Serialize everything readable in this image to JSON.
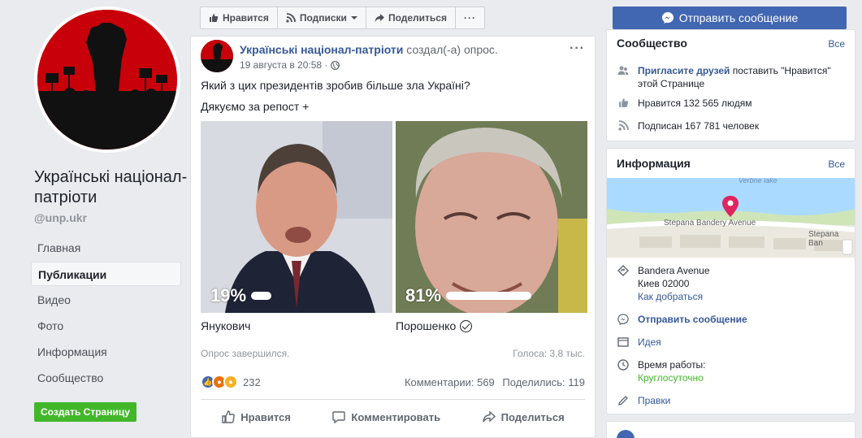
{
  "left": {
    "page_name": "Українські націонал-патріоти",
    "handle": "@unp.ukr",
    "nav": [
      "Главная",
      "Публикации",
      "Видео",
      "Фото",
      "Информация",
      "Сообщество"
    ],
    "create_page": "Создать Страницу"
  },
  "actionbar": {
    "like": "Нравится",
    "follow": "Подписки",
    "share": "Поделиться",
    "send_message": "Отправить сообщение"
  },
  "post": {
    "author": "Українські націонал-патріоти",
    "action": "создал(-а) опрос.",
    "date": "19 августа в 20:58 ·",
    "question": "Який з цих президентів зробив більше зла Україні?",
    "subtext": "Дякуємо за репост +",
    "options": [
      {
        "name": "Янукович",
        "percent_label": "19%",
        "percent": 19,
        "winner": false
      },
      {
        "name": "Порошенко",
        "percent_label": "81%",
        "percent": 81,
        "winner": true
      }
    ],
    "poll_status": "Опрос завершился.",
    "votes": "Голоса: 3,8 тыс.",
    "reaction_count": "232",
    "comments": "Комментарии: 569",
    "shares": "Поделились: 119",
    "btn_like": "Нравится",
    "btn_comment": "Комментировать",
    "btn_share": "Поделиться"
  },
  "community": {
    "title": "Сообщество",
    "see_all": "Все",
    "invite_link": "Пригласите друзей",
    "invite_rest": "поставить \"Нравится\" этой Странице",
    "likes": "Нравится 132 565 людям",
    "followers": "Подписан 167 781 человек"
  },
  "info": {
    "title": "Информация",
    "see_all": "Все",
    "map_label_1": "Stepana Bandery Avenue",
    "map_label_2": "Stepana Ban",
    "map_label_3": "Verbne lake",
    "address_1": "Bandera Avenue",
    "address_2": "Киев 02000",
    "directions": "Как добраться",
    "send_message": "Отправить сообщение",
    "idea": "Идея",
    "hours_label": "Время работы:",
    "hours_value": "Круглосуточно",
    "edits": "Правки"
  },
  "colors": {
    "brand_blue": "#4267b2",
    "link": "#365899",
    "green": "#42b72a",
    "map_pin": "#e0245e"
  }
}
